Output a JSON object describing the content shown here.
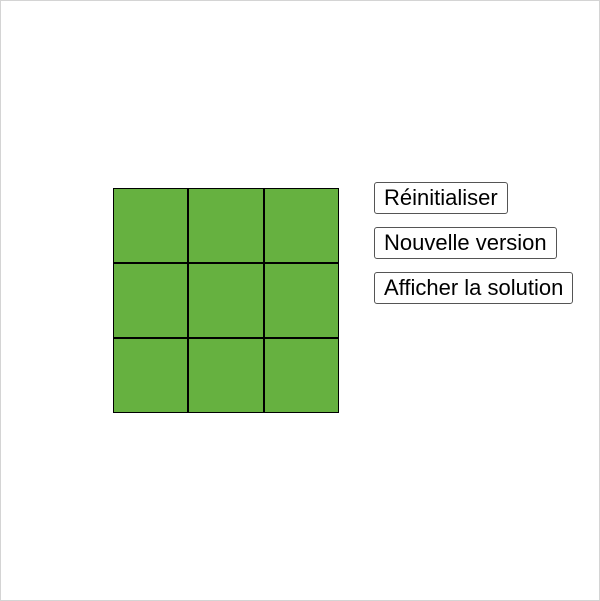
{
  "board": {
    "rows": 3,
    "cols": 3,
    "cell_color": "#66b140",
    "line_color": "#000000"
  },
  "controls": {
    "reset_label": "Réinitialiser",
    "new_version_label": "Nouvelle version",
    "show_solution_label": "Afficher la solution"
  }
}
